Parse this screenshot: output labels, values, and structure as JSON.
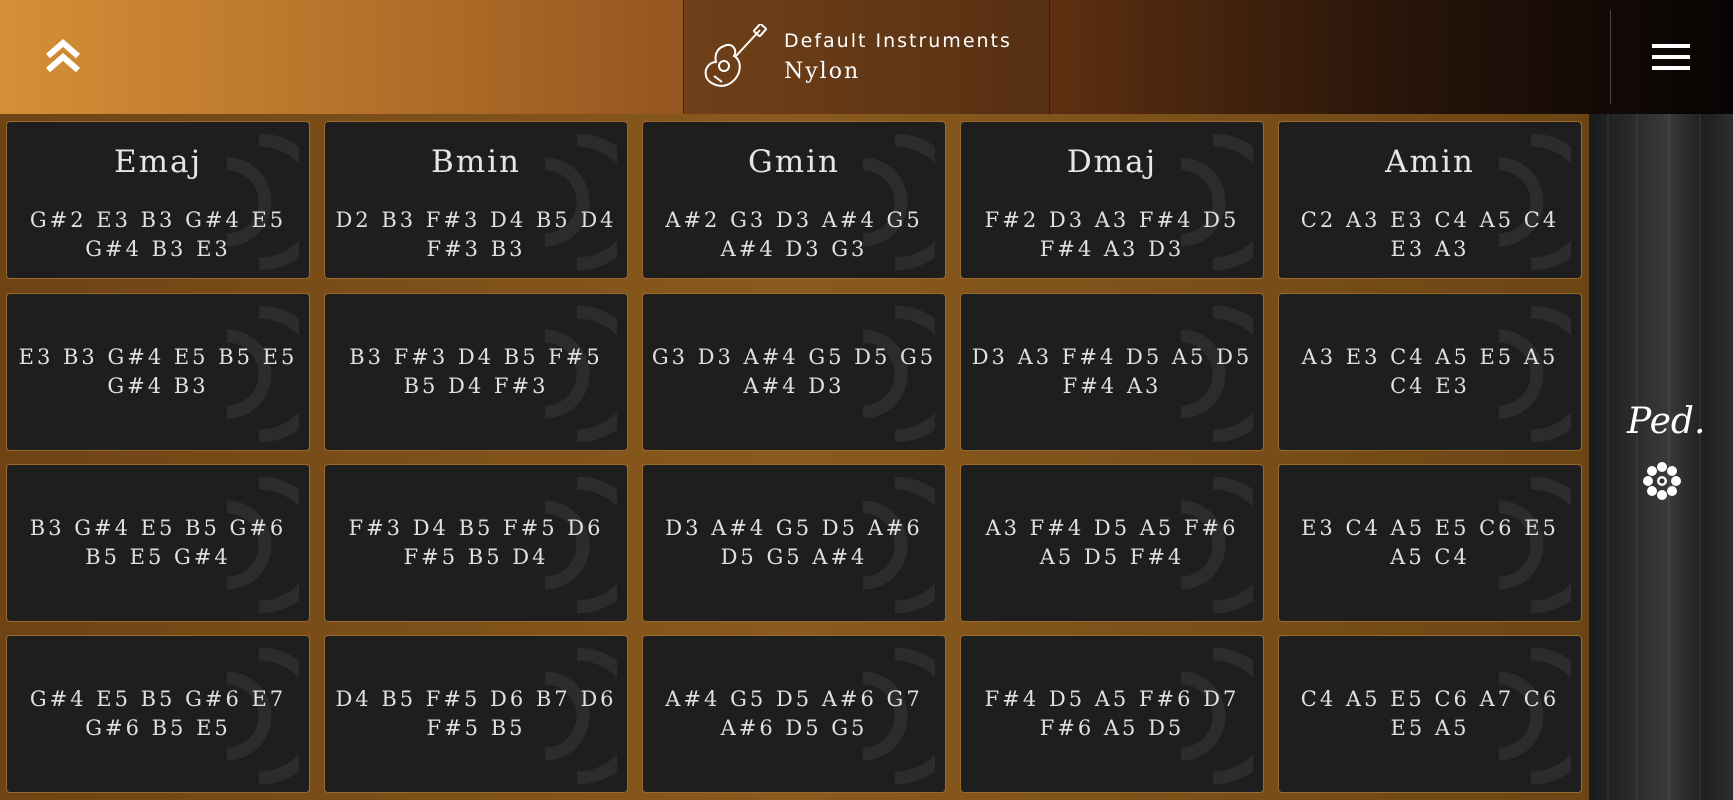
{
  "header": {
    "category": "Default Instruments",
    "instrument": "Nylon",
    "up_icon": "double-chevron-up-icon",
    "menu_icon": "hamburger-menu-icon",
    "instrument_icon": "acoustic-guitar-icon"
  },
  "pads": [
    {
      "title": "Emaj",
      "notes": "G#2 E3 B3 G#4 E5 G#4 B3 E3"
    },
    {
      "title": "Bmin",
      "notes": "D2 B3 F#3 D4 B5 D4 F#3 B3"
    },
    {
      "title": "Gmin",
      "notes": "A#2 G3 D3 A#4 G5 A#4 D3 G3"
    },
    {
      "title": "Dmaj",
      "notes": "F#2 D3 A3 F#4 D5 F#4 A3 D3"
    },
    {
      "title": "Amin",
      "notes": "C2 A3 E3 C4 A5 C4 E3 A3"
    },
    {
      "title": "",
      "notes": "E3 B3 G#4 E5 B5 E5 G#4 B3"
    },
    {
      "title": "",
      "notes": "B3 F#3 D4 B5 F#5 B5 D4 F#3"
    },
    {
      "title": "",
      "notes": "G3 D3 A#4 G5 D5 G5 A#4 D3"
    },
    {
      "title": "",
      "notes": "D3 A3 F#4 D5 A5 D5 F#4 A3"
    },
    {
      "title": "",
      "notes": "A3 E3 C4 A5 E5 A5 C4 E3"
    },
    {
      "title": "",
      "notes": "B3 G#4 E5 B5 G#6 B5 E5 G#4"
    },
    {
      "title": "",
      "notes": "F#3 D4 B5 F#5 D6 F#5 B5 D4"
    },
    {
      "title": "",
      "notes": "D3 A#4 G5 D5 A#6 D5 G5 A#4"
    },
    {
      "title": "",
      "notes": "A3 F#4 D5 A5 F#6 A5 D5 F#4"
    },
    {
      "title": "",
      "notes": "E3 C4 A5 E5 C6 E5 A5 C4"
    },
    {
      "title": "",
      "notes": "G#4 E5 B5 G#6 E7 G#6 B5 E5"
    },
    {
      "title": "",
      "notes": "D4 B5 F#5 D6 B7 D6 F#5 B5"
    },
    {
      "title": "",
      "notes": "A#4 G5 D5 A#6 G7 A#6 D5 G5"
    },
    {
      "title": "",
      "notes": "F#4 D5 A5 F#6 D7 F#6 A5 D5"
    },
    {
      "title": "",
      "notes": "C4 A5 E5 C6 A7 C6 E5 A5"
    }
  ],
  "sidebar": {
    "pedal_label": "Ped.",
    "pedal_release_icon": "pedal-release-flower-icon"
  }
}
